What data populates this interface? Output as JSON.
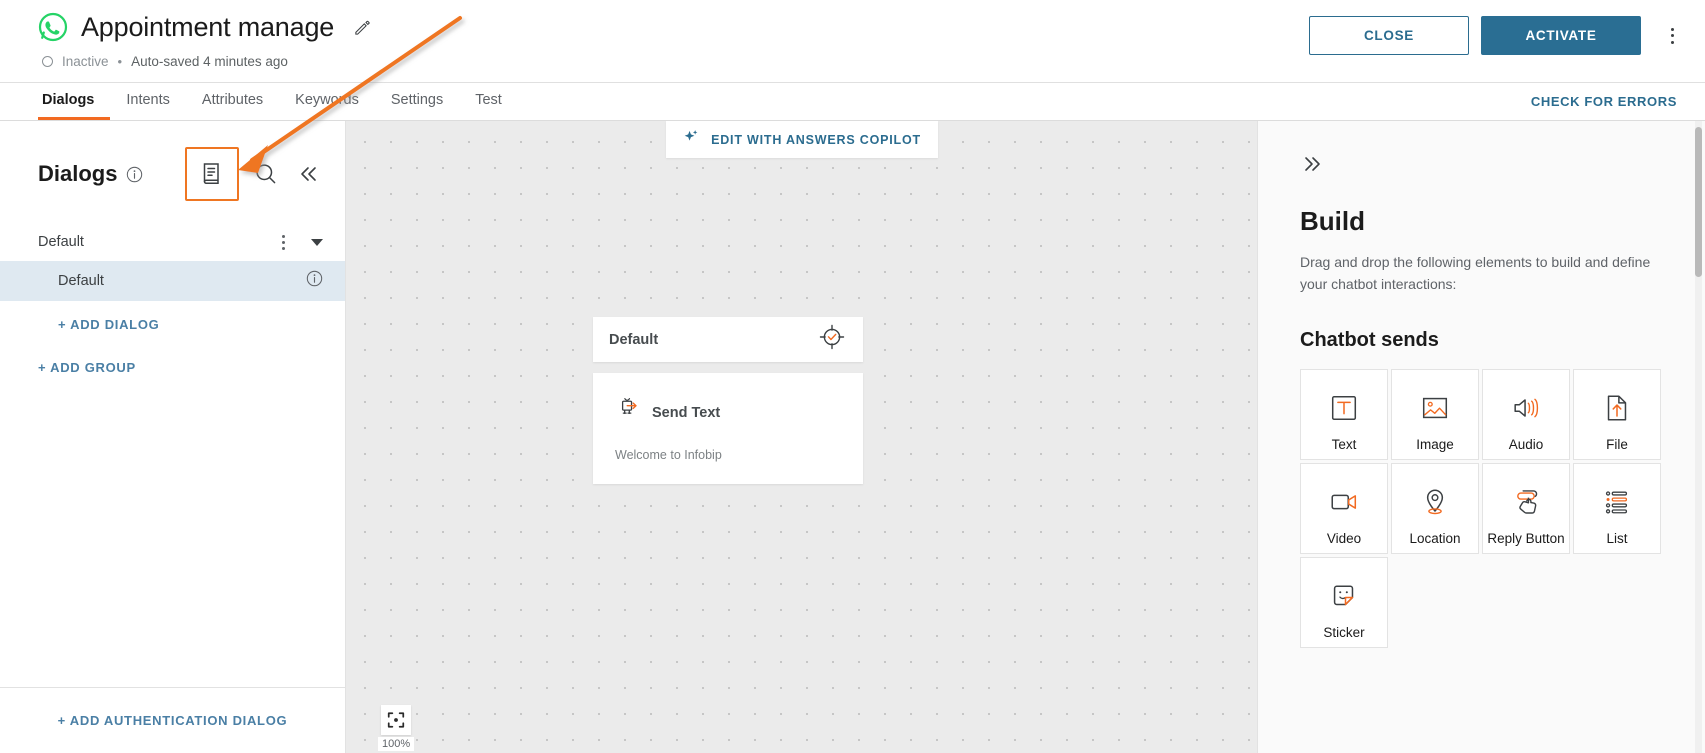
{
  "header": {
    "app_icon": "whatsapp-icon",
    "title": "Appointment manage",
    "edit_icon": "pencil-icon",
    "status": "Inactive",
    "separator": "•",
    "autosave": "Auto-saved 4 minutes ago",
    "close_label": "CLOSE",
    "activate_label": "ACTIVATE",
    "more_icon": "kebab-menu-icon",
    "accent_primary": "#2a6e93",
    "accent_orange": "#f26a21"
  },
  "tabs": {
    "items": [
      {
        "label": "Dialogs",
        "active": true
      },
      {
        "label": "Intents",
        "active": false
      },
      {
        "label": "Attributes",
        "active": false
      },
      {
        "label": "Keywords",
        "active": false
      },
      {
        "label": "Settings",
        "active": false
      },
      {
        "label": "Test",
        "active": false
      }
    ],
    "check_errors_label": "CHECK FOR ERRORS"
  },
  "sidebar": {
    "title": "Dialogs",
    "info_icon": "info-circle-icon",
    "library_icon": "dialog-library-icon",
    "search_icon": "search-icon",
    "collapse_icon": "chevron-double-left-icon",
    "group": {
      "name": "Default",
      "kebab_icon": "kebab-menu-icon",
      "caret_icon": "chevron-down-icon"
    },
    "dialogs": [
      {
        "name": "Default",
        "info_icon": "info-circle-icon",
        "selected": true
      }
    ],
    "add_dialog_label": "+ ADD DIALOG",
    "add_group_label": "+ ADD GROUP",
    "add_auth_dialog_label": "+ ADD AUTHENTICATION DIALOG"
  },
  "canvas": {
    "copilot_label": "EDIT WITH ANSWERS COPILOT",
    "copilot_icon": "sparkle-icon",
    "node": {
      "title": "Default",
      "target_icon": "target-check-icon"
    },
    "card": {
      "icon": "chatbot-send-icon",
      "title": "Send Text",
      "body": "Welcome to Infobip"
    },
    "zoom": {
      "fit_icon": "fit-to-screen-icon",
      "level": "100%"
    }
  },
  "build_panel": {
    "expand_icon": "chevron-double-right-icon",
    "title": "Build",
    "description": "Drag and drop the following elements to build and define your chatbot interactions:",
    "section_title": "Chatbot sends",
    "elements": [
      {
        "label": "Text",
        "icon": "text-icon"
      },
      {
        "label": "Image",
        "icon": "image-icon"
      },
      {
        "label": "Audio",
        "icon": "audio-icon"
      },
      {
        "label": "File",
        "icon": "file-upload-icon"
      },
      {
        "label": "Video",
        "icon": "video-icon"
      },
      {
        "label": "Location",
        "icon": "location-pin-icon"
      },
      {
        "label": "Reply Button",
        "icon": "reply-button-icon"
      },
      {
        "label": "List",
        "icon": "list-icon"
      },
      {
        "label": "Sticker",
        "icon": "sticker-icon"
      }
    ]
  }
}
